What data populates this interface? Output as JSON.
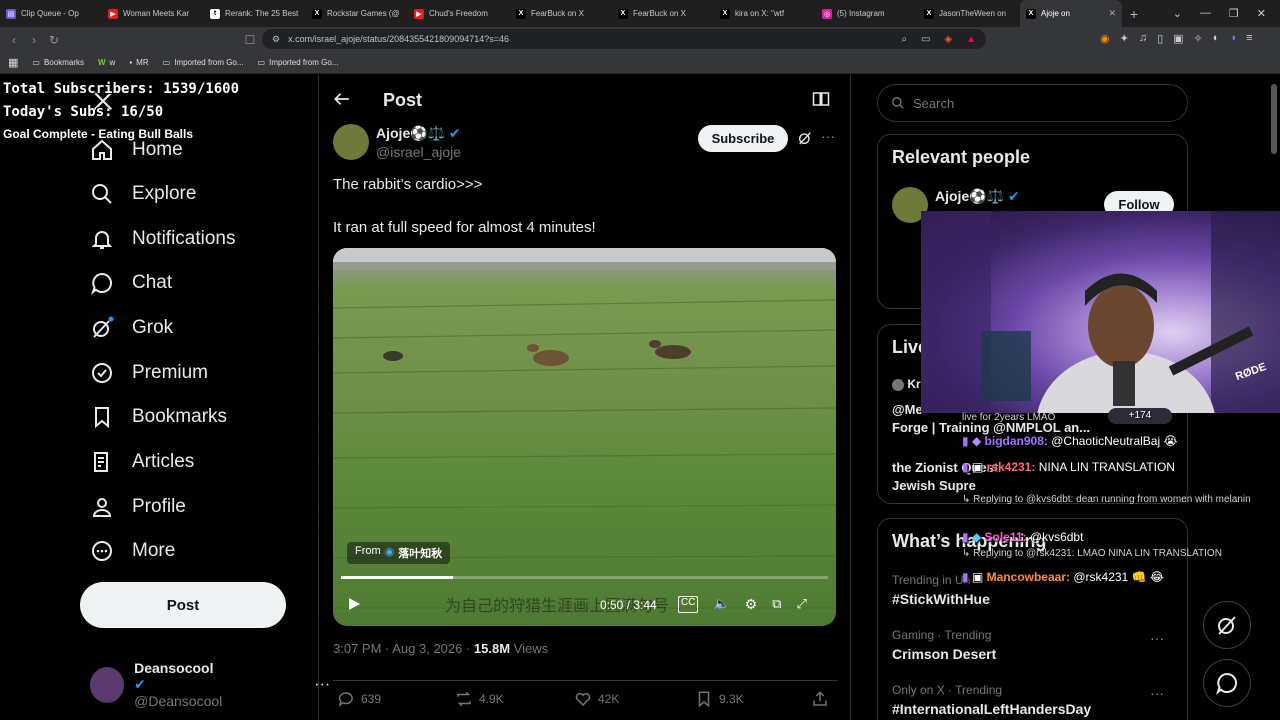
{
  "browser": {
    "tabs": [
      {
        "label": "Clip Queue - Op",
        "fav": "#6b5bd6",
        "glyph": "▤"
      },
      {
        "label": "Woman Meets Kar",
        "fav": "#e02020",
        "glyph": "▶"
      },
      {
        "label": "Rerank: The 25 Best",
        "fav": "#ffffff",
        "glyph": "t"
      },
      {
        "label": "Rockstar Games (@",
        "fav": "#000000",
        "glyph": "X"
      },
      {
        "label": "Chud's Freedom",
        "fav": "#e02020",
        "glyph": "▶"
      },
      {
        "label": "FearBuck on X",
        "fav": "#000000",
        "glyph": "X"
      },
      {
        "label": "FearBuck on X",
        "fav": "#000000",
        "glyph": "X"
      },
      {
        "label": "kira on X: \"wtf",
        "fav": "#000000",
        "glyph": "X"
      },
      {
        "label": "(5) Instagram",
        "fav": "#d6249f",
        "glyph": "◎"
      },
      {
        "label": "JasonTheWeen on",
        "fav": "#000000",
        "glyph": "X"
      },
      {
        "label": "Ajoje on",
        "fav": "#000000",
        "glyph": "X",
        "active": true
      }
    ],
    "url": "x.com/israel_ajoje/status/2084355421809094714?s=46",
    "bookmarks": [
      "Bookmarks",
      "w",
      "MR",
      "Imported from Go...",
      "Imported from Go..."
    ]
  },
  "overlay": {
    "line1": "Total Subscribers: 1539/1600",
    "line2": "Today's Subs: 16/50",
    "line3": "Goal Complete - Eating Bull Balls"
  },
  "nav": {
    "items": [
      "Home",
      "Explore",
      "Notifications",
      "Chat",
      "Grok",
      "Premium",
      "Bookmarks",
      "Articles",
      "Profile",
      "More"
    ],
    "post_button": "Post",
    "account": {
      "name": "Deansocool",
      "handle": "@Deansocool"
    }
  },
  "post": {
    "header": "Post",
    "author": {
      "name": "Ajoje⚽⚖️",
      "handle": "@israel_ajoje"
    },
    "subscribe": "Subscribe",
    "text1": "The rabbit’s cardio>>>",
    "text2": "It ran at full speed for almost 4 minutes!",
    "video": {
      "source_label": "From",
      "source_name": "落叶知秋",
      "subtitle": "为自己的狩猎生涯画上圆满句号",
      "time": "0:50 / 3:44",
      "progress": 0.23
    },
    "meta": {
      "time": "3:07 PM · Aug 3, 2026 · ",
      "views": "15.8M",
      "views_label": " Views"
    },
    "actions": {
      "replies": "639",
      "reposts": "4.9K",
      "likes": "42K",
      "bookmarks": "9.3K"
    }
  },
  "right": {
    "search_placeholder": "Search",
    "relevant_title": "Relevant people",
    "relevant_name": "Ajoje⚽⚖️",
    "follow": "Follow",
    "live_title": "Live",
    "live_item1": "Forge | Training @NMPLOL an...",
    "live_item1_pre": "@Me",
    "live_item2": "the Zionist Questi",
    "live_item3": "Jewish Supre",
    "whats_title": "What’s happening",
    "trends": [
      {
        "context": "Trending in Un",
        "name": "#StickWithHue"
      },
      {
        "context": "Gaming · Trending",
        "name": "Crimson Desert"
      },
      {
        "context": "Only on X · Trending",
        "name": "#InternationalLeftHandersDay"
      }
    ]
  },
  "stream": {
    "rode": "RØDE",
    "chat": [
      {
        "kind": "note",
        "text": "live for 2years LMAO"
      },
      {
        "kind": "msg",
        "user": "bigdan908:",
        "color": "#a472ff",
        "text": "@ChaoticNeutralBaj 😭"
      },
      {
        "kind": "msg",
        "user": "rsk4231:",
        "color": "#ff6a6a",
        "text": "NINA LIN TRANSLATION"
      },
      {
        "kind": "reply",
        "text": "↳ Replying to @kvs6dbt: dean running from women with melanin"
      },
      {
        "kind": "msg",
        "user": "Sole11:",
        "color": "#ff5ad0",
        "text": "@kvs6dbt"
      },
      {
        "kind": "reply",
        "text": "↳ Replying to @rsk4231: LMAO NINA LIN TRANSLATION"
      },
      {
        "kind": "msg",
        "user": "Mancowbeaar:",
        "color": "#ff8a3d",
        "text": "@rsk4231 👊 😂"
      }
    ],
    "badge": "+174"
  }
}
